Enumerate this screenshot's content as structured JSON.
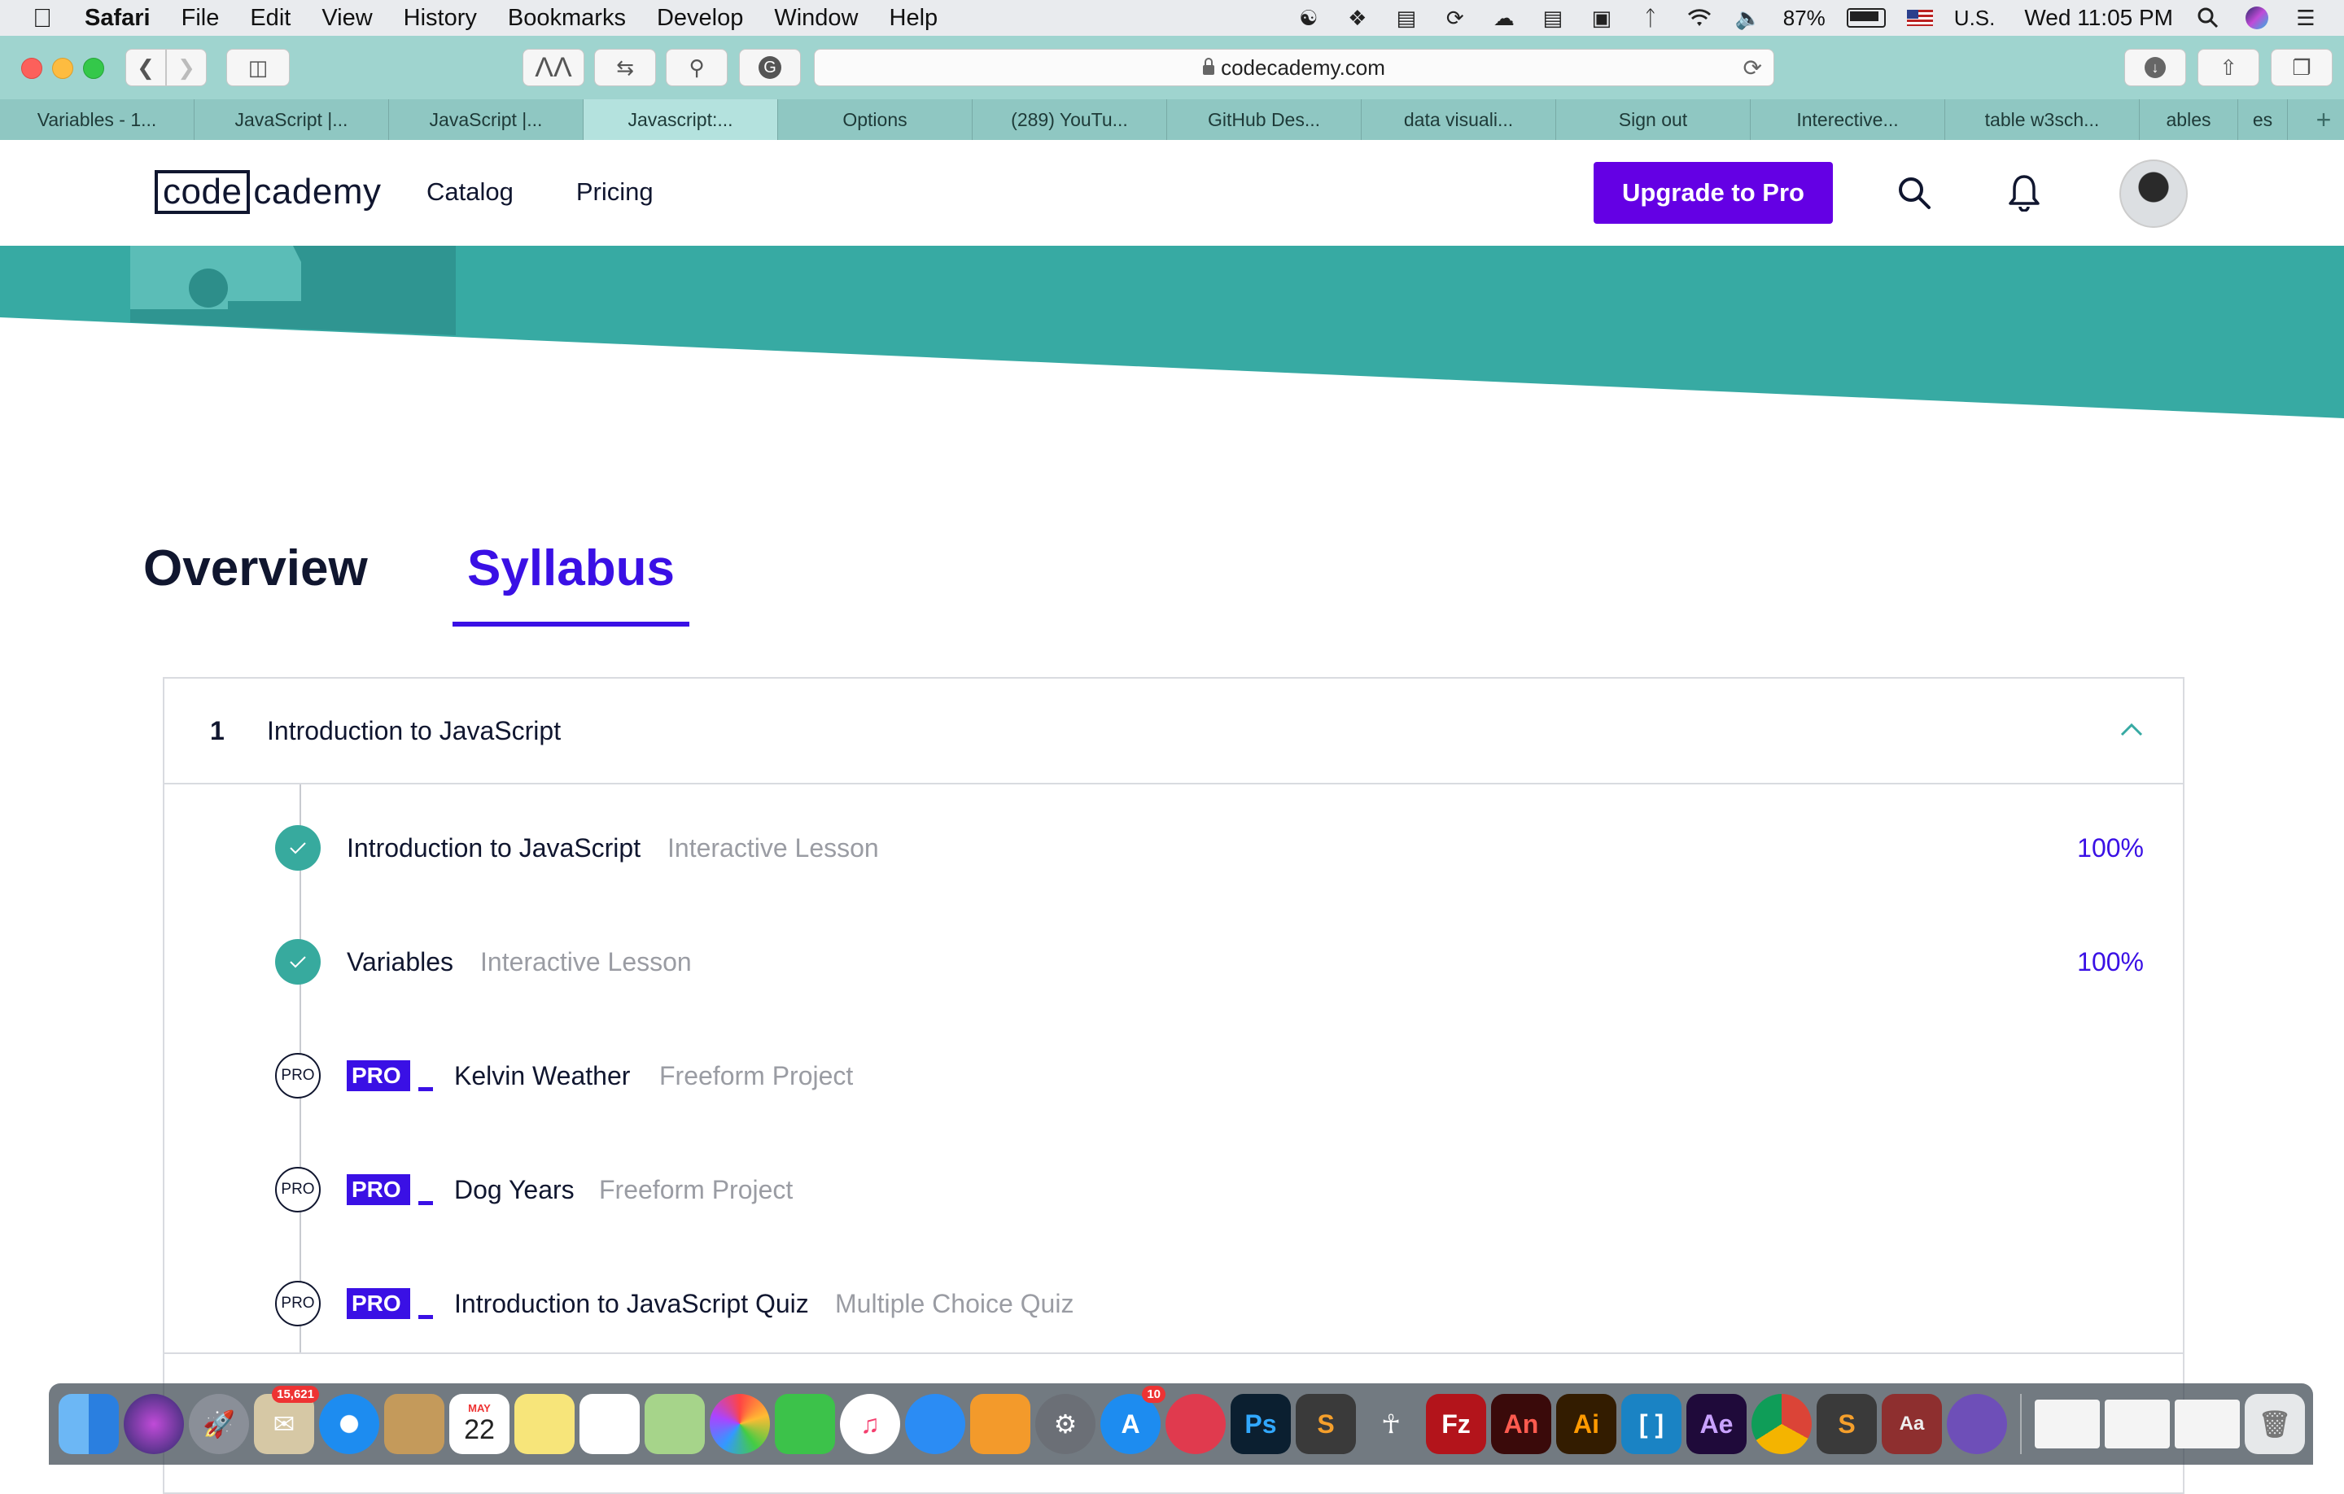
{
  "menubar": {
    "app": "Safari",
    "items": [
      "File",
      "Edit",
      "View",
      "History",
      "Bookmarks",
      "Develop",
      "Window",
      "Help"
    ],
    "battery_percent": "87%",
    "battery_level": 0.87,
    "input_source": "U.S.",
    "clock": "Wed 11:05 PM"
  },
  "browser": {
    "url": "codecademy.com",
    "tabs": [
      "Variables - 1...",
      "JavaScript |...",
      "JavaScript |...",
      "Javascript:...",
      "Options",
      "(289) YouTu...",
      "GitHub Des...",
      "data visuali...",
      "Sign out",
      "Interective...",
      "table w3sch...",
      "ables",
      "es"
    ],
    "active_tab_index": 3
  },
  "site": {
    "logo_left": "code",
    "logo_right": "cademy",
    "nav": [
      "Catalog",
      "Pricing"
    ],
    "upgrade_label": "Upgrade to Pro",
    "brand_color": "#6400e4",
    "banner_color": "#37aaa3"
  },
  "page_tabs": {
    "overview": "Overview",
    "syllabus": "Syllabus",
    "active": "Syllabus"
  },
  "module": {
    "number": "1",
    "title": "Introduction to JavaScript",
    "expanded": true,
    "items": [
      {
        "title": "Introduction to JavaScript",
        "type": "Interactive Lesson",
        "progress": "100%",
        "status": "complete",
        "pro": false
      },
      {
        "title": "Variables",
        "type": "Interactive Lesson",
        "progress": "100%",
        "status": "complete",
        "pro": false
      },
      {
        "title": "Kelvin Weather",
        "type": "Freeform Project",
        "progress": "",
        "status": "locked",
        "pro": true,
        "badge": "PRO"
      },
      {
        "title": "Dog Years",
        "type": "Freeform Project",
        "progress": "",
        "status": "locked",
        "pro": true,
        "badge": "PRO"
      },
      {
        "title": "Introduction to JavaScript Quiz",
        "type": "Multiple Choice Quiz",
        "progress": "",
        "status": "locked",
        "pro": true,
        "badge": "PRO"
      }
    ],
    "pro_marker": "PRO"
  },
  "dock": {
    "badges": {
      "mail": "15,621",
      "app_store": "10"
    },
    "calendar": {
      "month": "MAY",
      "day": "22"
    },
    "app_labels": {
      "photoshop": "Ps",
      "animate": "An",
      "illustrator": "Ai",
      "after_effects": "Ae",
      "dictionary": "Aa"
    }
  }
}
